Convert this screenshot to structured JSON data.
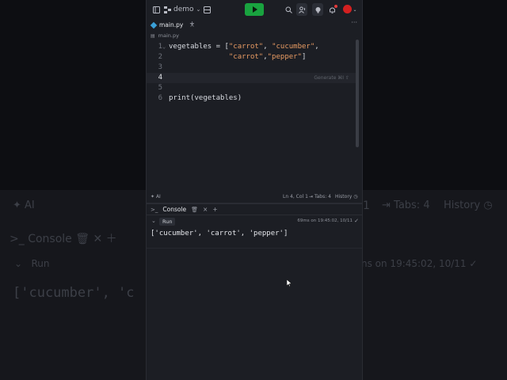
{
  "background": {
    "ai_label": "AI",
    "tabs_label": "Tabs: 4",
    "history_label": "History",
    "line_fragment": "1",
    "console_label": "Console",
    "run_label": "Run",
    "meta_fragment": "ns on 19:45:02, 10/11",
    "output_fragment": "['cucumber', 'c"
  },
  "topbar": {
    "project": "demo"
  },
  "tabs": {
    "file": "main.py",
    "add": "+",
    "more": "···"
  },
  "breadcrumb": {
    "file": "main.py"
  },
  "editor": {
    "lines": [
      {
        "num": "1",
        "parts": [
          {
            "t": "vegetables = [",
            "c": "code"
          },
          {
            "t": "\"carrot\"",
            "c": "str"
          },
          {
            "t": ", ",
            "c": "code"
          },
          {
            "t": "\"cucumber\"",
            "c": "str"
          },
          {
            "t": ",",
            "c": "code"
          }
        ]
      },
      {
        "num": "2",
        "parts": [
          {
            "t": "              ",
            "c": "code"
          },
          {
            "t": "\"carrot\"",
            "c": "str"
          },
          {
            "t": ",",
            "c": "code"
          },
          {
            "t": "\"pepper\"",
            "c": "str"
          },
          {
            "t": "]",
            "c": "code"
          }
        ]
      },
      {
        "num": "3",
        "parts": []
      },
      {
        "num": "4",
        "parts": []
      },
      {
        "num": "5",
        "parts": []
      },
      {
        "num": "6",
        "parts": [
          {
            "t": "print(vegetables)",
            "c": "code"
          }
        ]
      }
    ],
    "ghost_hint": "Generate  ⌘I  ⇧"
  },
  "statusbar": {
    "ai": "AI",
    "position": "Ln 4, Col 1",
    "tabs": "Tabs: 4",
    "history": "History"
  },
  "console": {
    "title": "Console",
    "add": "+",
    "run": "Run",
    "meta": "69ms on 19:45:02, 10/11",
    "output": "['cucumber', 'carrot', 'pepper']"
  },
  "colors": {
    "run_button": "#19a33f",
    "string": "#e89b63",
    "avatar": "#d42020"
  }
}
